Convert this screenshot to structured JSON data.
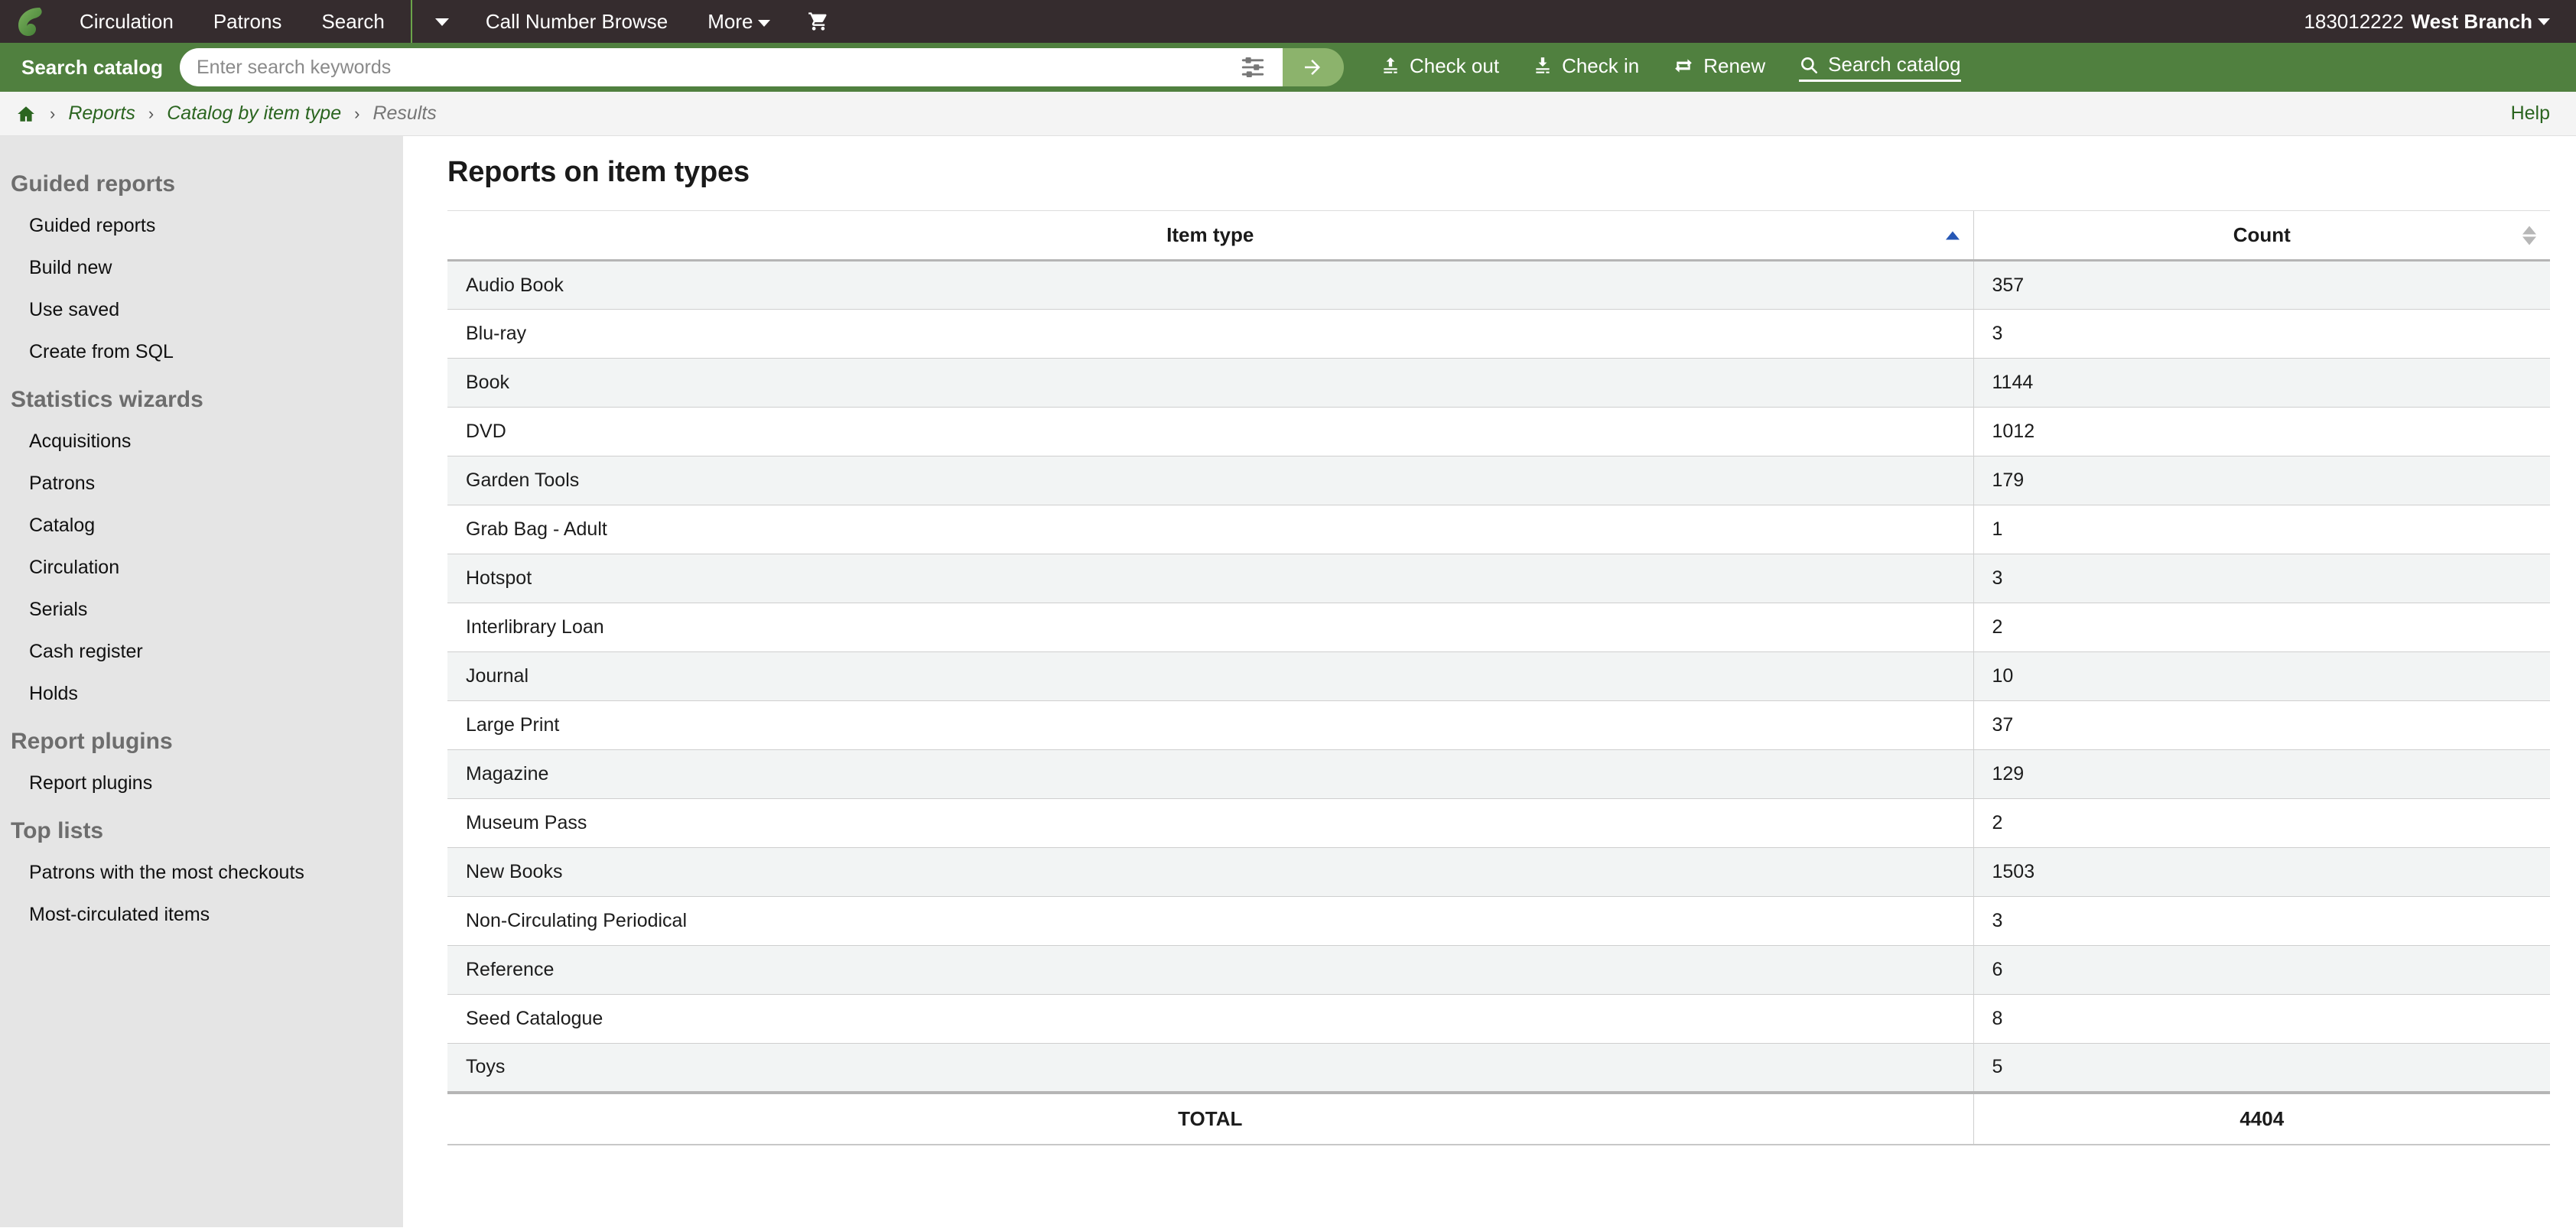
{
  "topnav": {
    "logo_name": "koha-logo",
    "items": [
      {
        "label": "Circulation",
        "name": "nav-circulation"
      },
      {
        "label": "Patrons",
        "name": "nav-patrons"
      },
      {
        "label": "Search",
        "name": "nav-search"
      }
    ],
    "dropdown_caret_label": "",
    "items_after": [
      {
        "label": "Call Number Browse",
        "name": "nav-call-number-browse"
      },
      {
        "label": "More",
        "name": "nav-more",
        "caret": true
      }
    ],
    "cart_icon": "shopping-cart-icon",
    "user": {
      "number": "183012222",
      "branch": "West Branch"
    }
  },
  "searchbar": {
    "tab_label": "Search catalog",
    "placeholder": "Enter search keywords",
    "value": "",
    "filter_icon": "sliders-icon",
    "submit_icon": "arrow-right-icon",
    "actions": [
      {
        "label": "Check out",
        "icon": "check-out-icon",
        "active": false
      },
      {
        "label": "Check in",
        "icon": "check-in-icon",
        "active": false
      },
      {
        "label": "Renew",
        "icon": "renew-icon",
        "active": false
      },
      {
        "label": "Search catalog",
        "icon": "search-icon",
        "active": true
      }
    ]
  },
  "breadcrumb": {
    "home_icon": "home-icon",
    "separator": "›",
    "items": [
      {
        "label": "Reports",
        "current": false
      },
      {
        "label": "Catalog by item type",
        "current": false
      },
      {
        "label": "Results",
        "current": true
      }
    ],
    "help_label": "Help"
  },
  "sidebar": {
    "groups": [
      {
        "heading": "Guided reports",
        "items": [
          "Guided reports",
          "Build new",
          "Use saved",
          "Create from SQL"
        ]
      },
      {
        "heading": "Statistics wizards",
        "items": [
          "Acquisitions",
          "Patrons",
          "Catalog",
          "Circulation",
          "Serials",
          "Cash register",
          "Holds"
        ]
      },
      {
        "heading": "Report plugins",
        "items": [
          "Report plugins"
        ]
      },
      {
        "heading": "Top lists",
        "items": [
          "Patrons with the most checkouts",
          "Most-circulated items"
        ]
      }
    ]
  },
  "main": {
    "title": "Reports on item types",
    "table": {
      "columns": [
        {
          "label": "Item type",
          "sort": "asc"
        },
        {
          "label": "Count",
          "sort": "none"
        }
      ],
      "rows": [
        {
          "item_type": "Audio Book",
          "count": "357"
        },
        {
          "item_type": "Blu-ray",
          "count": "3"
        },
        {
          "item_type": "Book",
          "count": "1144"
        },
        {
          "item_type": "DVD",
          "count": "1012"
        },
        {
          "item_type": "Garden Tools",
          "count": "179"
        },
        {
          "item_type": "Grab Bag - Adult",
          "count": "1"
        },
        {
          "item_type": "Hotspot",
          "count": "3"
        },
        {
          "item_type": "Interlibrary Loan",
          "count": "2"
        },
        {
          "item_type": "Journal",
          "count": "10"
        },
        {
          "item_type": "Large Print",
          "count": "37"
        },
        {
          "item_type": "Magazine",
          "count": "129"
        },
        {
          "item_type": "Museum Pass",
          "count": "2"
        },
        {
          "item_type": "New Books",
          "count": "1503"
        },
        {
          "item_type": "Non-Circulating Periodical",
          "count": "3"
        },
        {
          "item_type": "Reference",
          "count": "6"
        },
        {
          "item_type": "Seed Catalogue",
          "count": "8"
        },
        {
          "item_type": "Toys",
          "count": "5"
        }
      ],
      "total_label": "TOTAL",
      "total_value": "4404"
    }
  },
  "colors": {
    "nav_bg": "#352c2e",
    "search_bg": "#50803f",
    "accent_green": "#2b6520",
    "sidebar_bg": "#e5e5e5",
    "sort_active": "#2557b5"
  }
}
